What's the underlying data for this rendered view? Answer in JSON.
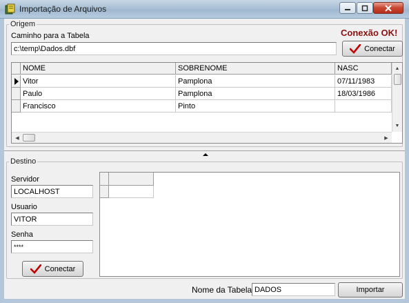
{
  "window": {
    "title": "Importação de Arquivos"
  },
  "origem": {
    "group_label": "Origem",
    "path_label": "Caminho para a Tabela",
    "path_value": "c:\\temp\\Dados.dbf",
    "status": "Conexão OK!",
    "connect_label": "Conectar",
    "grid": {
      "columns": [
        "NOME",
        "SOBRENOME",
        "NASC"
      ],
      "rows": [
        [
          "Vitor",
          "Pamplona",
          "07/11/1983"
        ],
        [
          "Paulo",
          "Pamplona",
          "18/03/1986"
        ],
        [
          "Francisco",
          "Pinto",
          ""
        ]
      ]
    }
  },
  "destino": {
    "group_label": "Destino",
    "server_label": "Servidor",
    "server_value": "LOCALHOST",
    "user_label": "Usuario",
    "user_value": "VITOR",
    "password_label": "Senha",
    "password_value": "****",
    "connect_label": "Conectar"
  },
  "footer": {
    "table_name_label": "Nome da Tabela",
    "table_name_value": "DADOS",
    "import_label": "Importar"
  },
  "colors": {
    "status_ok": "#8b1010",
    "check_mark": "#c00000"
  },
  "icons": {
    "app": "app-icon",
    "minimize": "minimize-icon",
    "maximize": "maximize-icon",
    "close": "close-icon",
    "check": "check-icon",
    "row_pointer": "row-pointer-icon",
    "splitter": "splitter-arrow-icon"
  }
}
